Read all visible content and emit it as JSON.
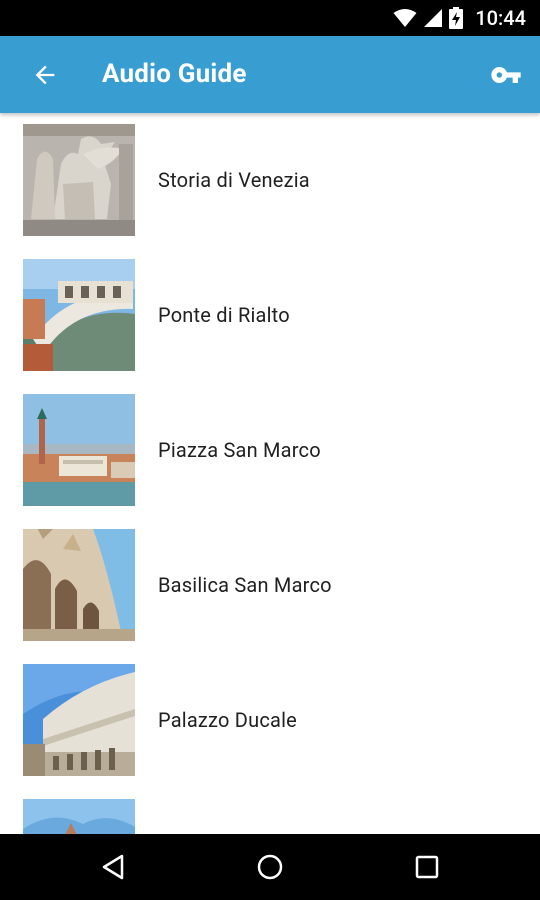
{
  "status_bar": {
    "time": "10:44",
    "icons": [
      "wifi-icon",
      "cell-signal-icon",
      "battery-charging-icon"
    ]
  },
  "app_bar": {
    "title": "Audio Guide",
    "back_icon": "arrow-back-icon",
    "action_icon": "key-icon",
    "color": "#389ED2"
  },
  "list": {
    "items": [
      {
        "label": "Storia di Venezia",
        "thumbnail": "winged-lion-relief"
      },
      {
        "label": "Ponte di Rialto",
        "thumbnail": "rialto-bridge"
      },
      {
        "label": "Piazza San Marco",
        "thumbnail": "san-marco-aerial"
      },
      {
        "label": "Basilica San Marco",
        "thumbnail": "basilica-facade"
      },
      {
        "label": "Palazzo Ducale",
        "thumbnail": "doges-palace"
      },
      {
        "label": "",
        "thumbnail": "partial-item"
      }
    ]
  },
  "nav_bar": {
    "icons": [
      "nav-back-icon",
      "nav-home-icon",
      "nav-recents-icon"
    ]
  }
}
